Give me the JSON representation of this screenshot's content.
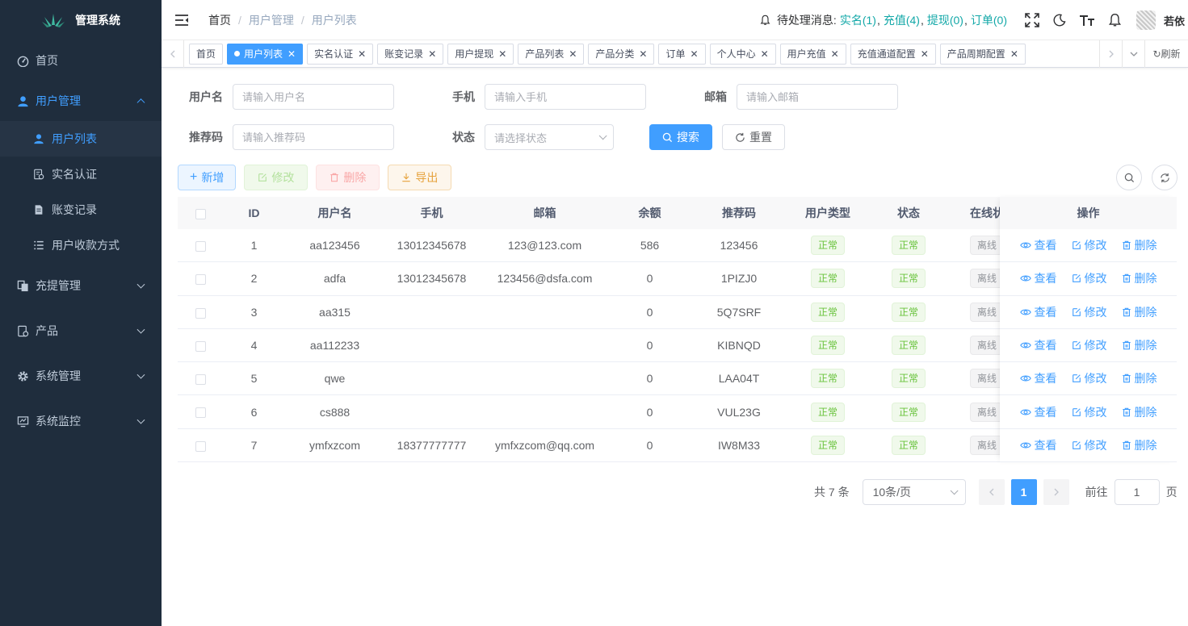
{
  "sidebar": {
    "title": "管理系统",
    "menu": {
      "home": "首页",
      "user_mgmt": "用户管理",
      "user_list": "用户列表",
      "realname": "实名认证",
      "ledger": "账变记录",
      "payment_method": "用户收款方式",
      "recharge_mgmt": "充提管理",
      "product": "产品",
      "system_mgmt": "系统管理",
      "system_monitor": "系统监控"
    }
  },
  "navbar": {
    "breadcrumb": [
      "首页",
      "用户管理",
      "用户列表"
    ],
    "pending_label": "待处理消息:",
    "pending": [
      "实名(1)",
      "充值(4)",
      "提现(0)",
      "订单(0)"
    ],
    "username": "若依"
  },
  "tags": {
    "items": [
      "首页",
      "用户列表",
      "实名认证",
      "账变记录",
      "用户提现",
      "产品列表",
      "产品分类",
      "订单",
      "个人中心",
      "用户充值",
      "充值通道配置",
      "产品周期配置"
    ],
    "refresh": "刷新"
  },
  "search": {
    "username_label": "用户名",
    "username_placeholder": "请输入用户名",
    "phone_label": "手机",
    "phone_placeholder": "请输入手机",
    "email_label": "邮箱",
    "email_placeholder": "请输入邮箱",
    "refcode_label": "推荐码",
    "refcode_placeholder": "请输入推荐码",
    "status_label": "状态",
    "status_placeholder": "请选择状态",
    "search_btn": "搜索",
    "reset_btn": "重置"
  },
  "toolbar": {
    "add": "新增",
    "edit": "修改",
    "delete": "删除",
    "export": "导出"
  },
  "table": {
    "headers": [
      "ID",
      "用户名",
      "手机",
      "邮箱",
      "余额",
      "推荐码",
      "用户类型",
      "状态",
      "在线状",
      "操作"
    ],
    "rows": [
      {
        "id": "1",
        "username": "aa123456",
        "phone": "13012345678",
        "email": "123@123.com",
        "balance": "586",
        "refcode": "123456",
        "type": "正常",
        "status": "正常",
        "online": "离线"
      },
      {
        "id": "2",
        "username": "adfa",
        "phone": "13012345678",
        "email": "123456@dsfa.com",
        "balance": "0",
        "refcode": "1PIZJ0",
        "type": "正常",
        "status": "正常",
        "online": "离线"
      },
      {
        "id": "3",
        "username": "aa315",
        "phone": "",
        "email": "",
        "balance": "0",
        "refcode": "5Q7SRF",
        "type": "正常",
        "status": "正常",
        "online": "离线"
      },
      {
        "id": "4",
        "username": "aa112233",
        "phone": "",
        "email": "",
        "balance": "0",
        "refcode": "KIBNQD",
        "type": "正常",
        "status": "正常",
        "online": "离线"
      },
      {
        "id": "5",
        "username": "qwe",
        "phone": "",
        "email": "",
        "balance": "0",
        "refcode": "LAA04T",
        "type": "正常",
        "status": "正常",
        "online": "离线"
      },
      {
        "id": "6",
        "username": "cs888",
        "phone": "",
        "email": "",
        "balance": "0",
        "refcode": "VUL23G",
        "type": "正常",
        "status": "正常",
        "online": "离线"
      },
      {
        "id": "7",
        "username": "ymfxzcom",
        "phone": "18377777777",
        "email": "ymfxzcom@qq.com",
        "balance": "0",
        "refcode": "IW8M33",
        "type": "正常",
        "status": "正常",
        "online": "离线"
      }
    ],
    "ops": {
      "view": "查看",
      "edit": "修改",
      "delete": "删除"
    }
  },
  "pagination": {
    "total": "共 7 条",
    "page_size": "10条/页",
    "current": "1",
    "goto_label": "前往",
    "goto_value": "1",
    "page_suffix": "页"
  },
  "colors": {
    "sidebar_bg": "#1f2d3d",
    "primary": "#409eff",
    "success": "#67c23a",
    "pending_link": "#13a8a8"
  }
}
